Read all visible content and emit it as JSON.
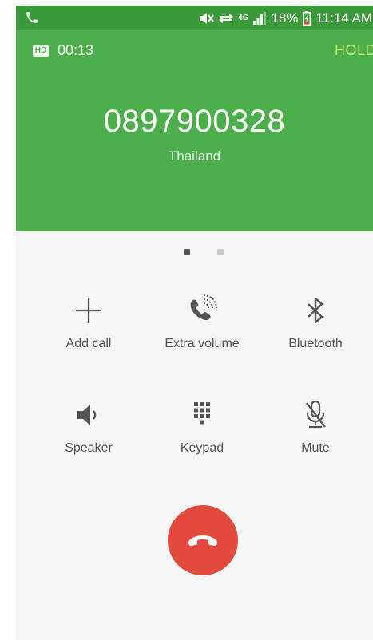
{
  "status_bar": {
    "network_type": "4G",
    "battery_percent": "18%",
    "time": "11:14 AM",
    "icons": [
      "phone-call-icon",
      "mute-icon",
      "data-transfer-icon",
      "4g-icon",
      "signal-icon",
      "battery-charging-icon"
    ]
  },
  "call": {
    "hd_label": "HD",
    "duration": "00:13",
    "hold_label": "HOLD",
    "number": "0897900328",
    "location": "Thailand"
  },
  "pager": {
    "current_page": 1,
    "total_pages": 2
  },
  "controls": {
    "add_call": "Add call",
    "extra_volume": "Extra volume",
    "bluetooth": "Bluetooth",
    "speaker": "Speaker",
    "keypad": "Keypad",
    "mute": "Mute"
  },
  "colors": {
    "header_green": "#4caf4c",
    "status_green": "#3b9a39",
    "hold_accent": "#c9f17a",
    "end_call_red": "#e14a3c",
    "icon_dark": "#555555",
    "background": "#f7f7f7"
  }
}
